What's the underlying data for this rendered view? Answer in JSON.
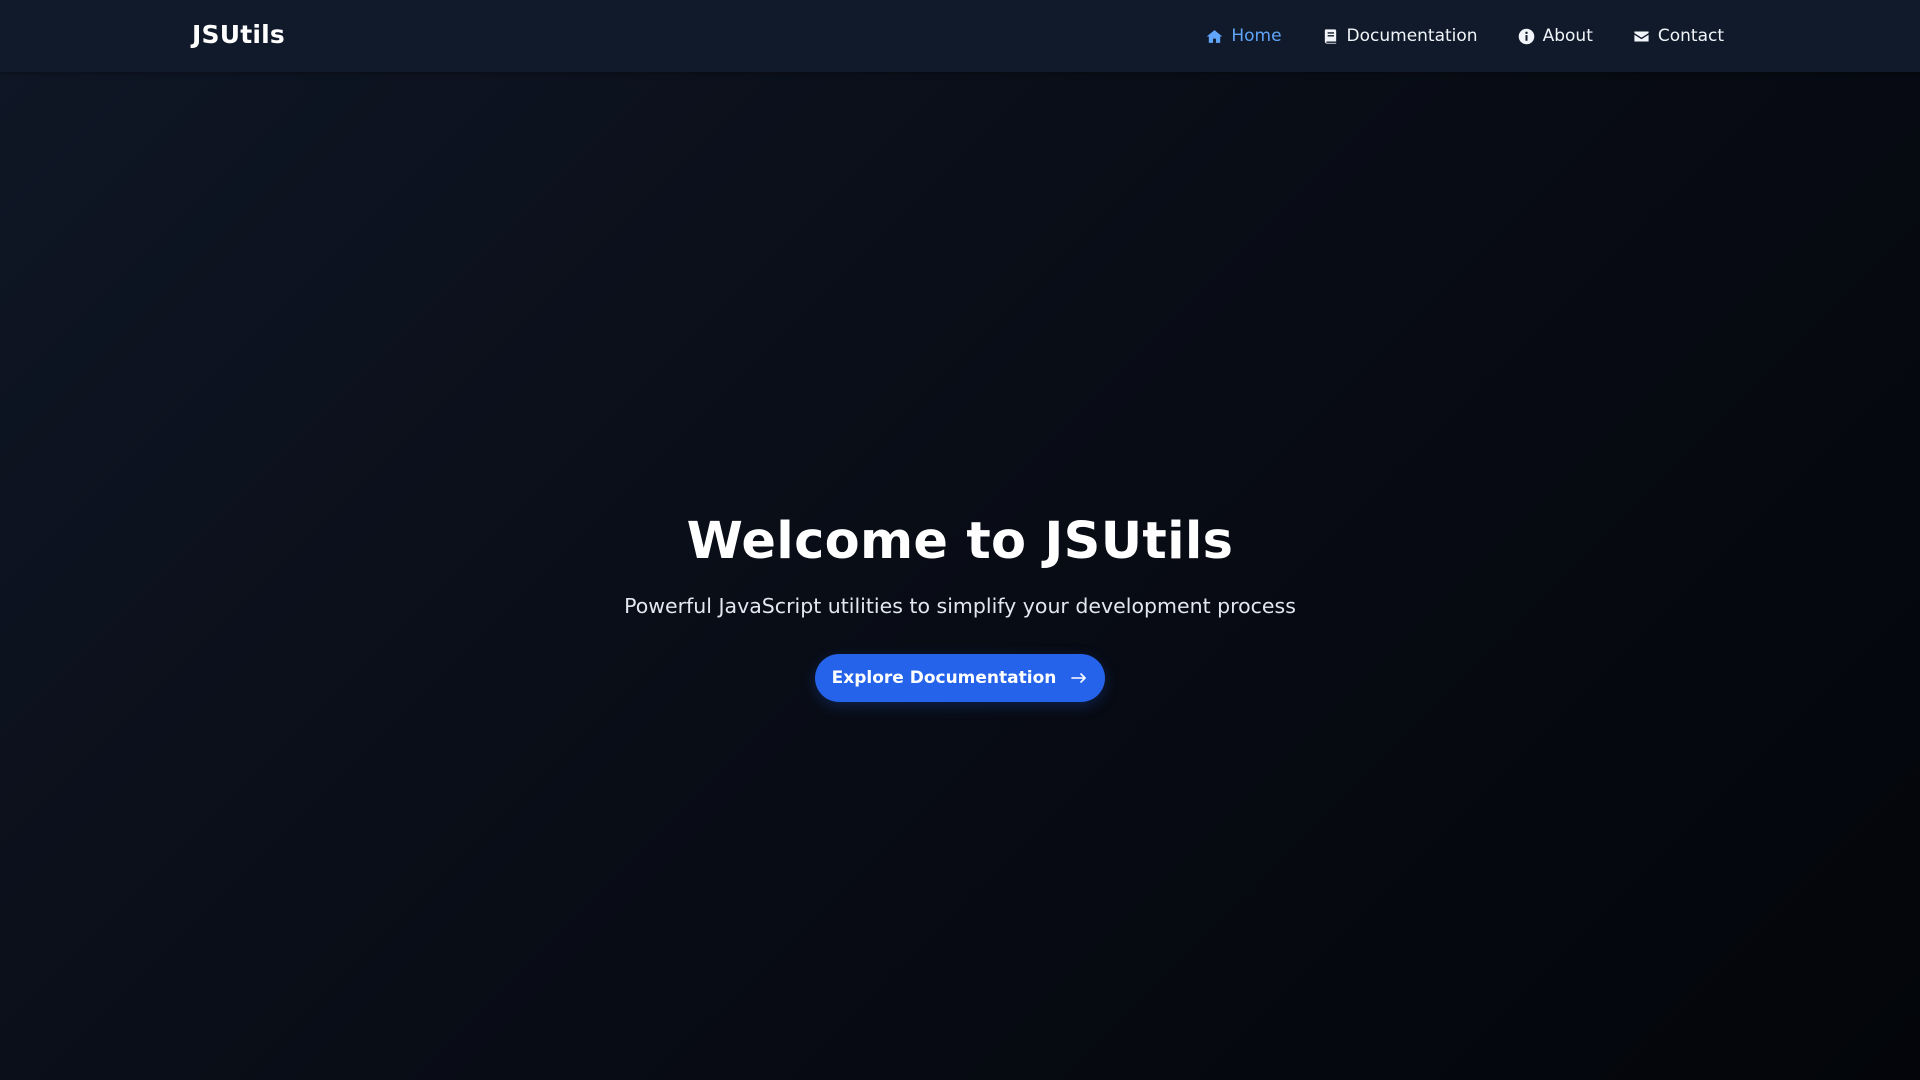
{
  "brand": {
    "name": "JSUtils"
  },
  "nav": {
    "items": [
      {
        "label": "Home",
        "icon": "home-icon",
        "active": true
      },
      {
        "label": "Documentation",
        "icon": "book-icon",
        "active": false
      },
      {
        "label": "About",
        "icon": "info-circle-icon",
        "active": false
      },
      {
        "label": "Contact",
        "icon": "envelope-icon",
        "active": false
      }
    ]
  },
  "hero": {
    "title": "Welcome to JSUtils",
    "subtitle": "Powerful JavaScript utilities to simplify your development process",
    "cta_label": "Explore Documentation",
    "cta_icon": "arrow-right-icon"
  },
  "colors": {
    "accent": "#2563eb",
    "active_link": "#60a5fa",
    "navbar_bg": "#111a2b",
    "page_bg_start": "#0f1726",
    "page_bg_end": "#03050a"
  }
}
